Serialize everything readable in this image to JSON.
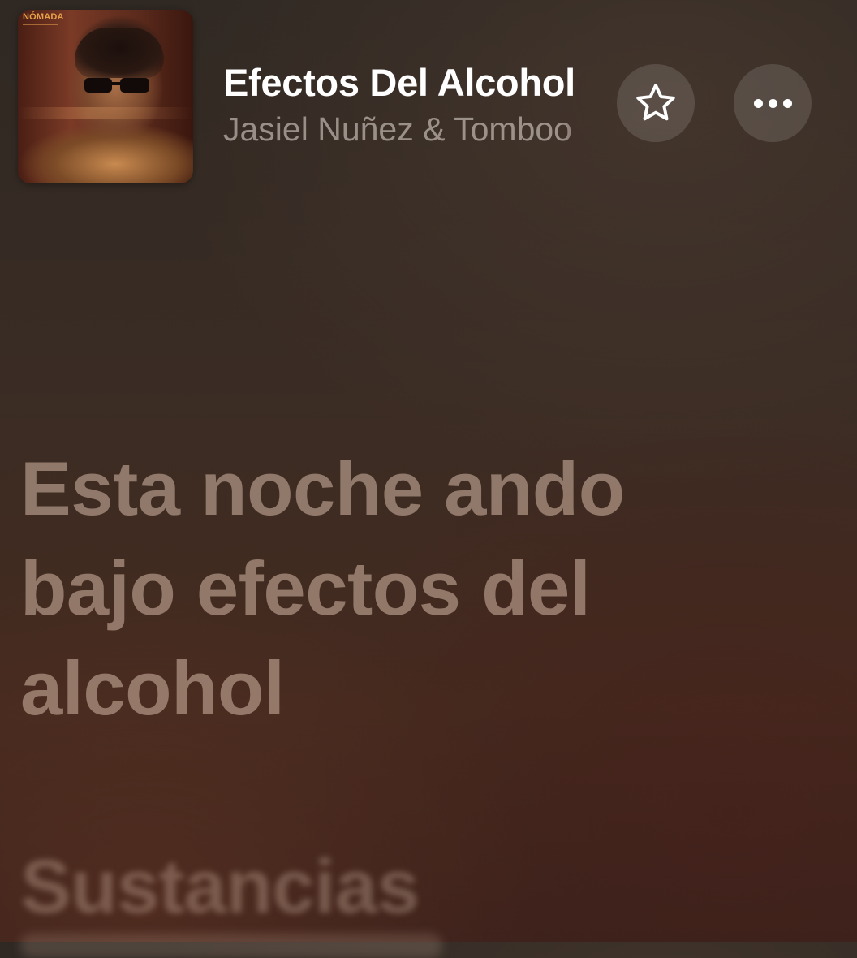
{
  "now_playing": {
    "title": "Efectos Del Alcohol",
    "artist": "Jasiel Nuñez & Tomboo",
    "artwork": {
      "label": "NÓMADA"
    }
  },
  "controls": {
    "favorite_icon": "star-outline-icon",
    "more_icon": "ellipsis-icon"
  },
  "lyrics": {
    "current_lines": [
      "Esta noche ando",
      "bajo efectos del",
      "alcohol"
    ],
    "next_line": "Sustancias"
  },
  "colors": {
    "background_top": "#2f2823",
    "background_bottom": "#452a1f",
    "title": "#ffffff",
    "lyric_active": "#c4a896"
  }
}
